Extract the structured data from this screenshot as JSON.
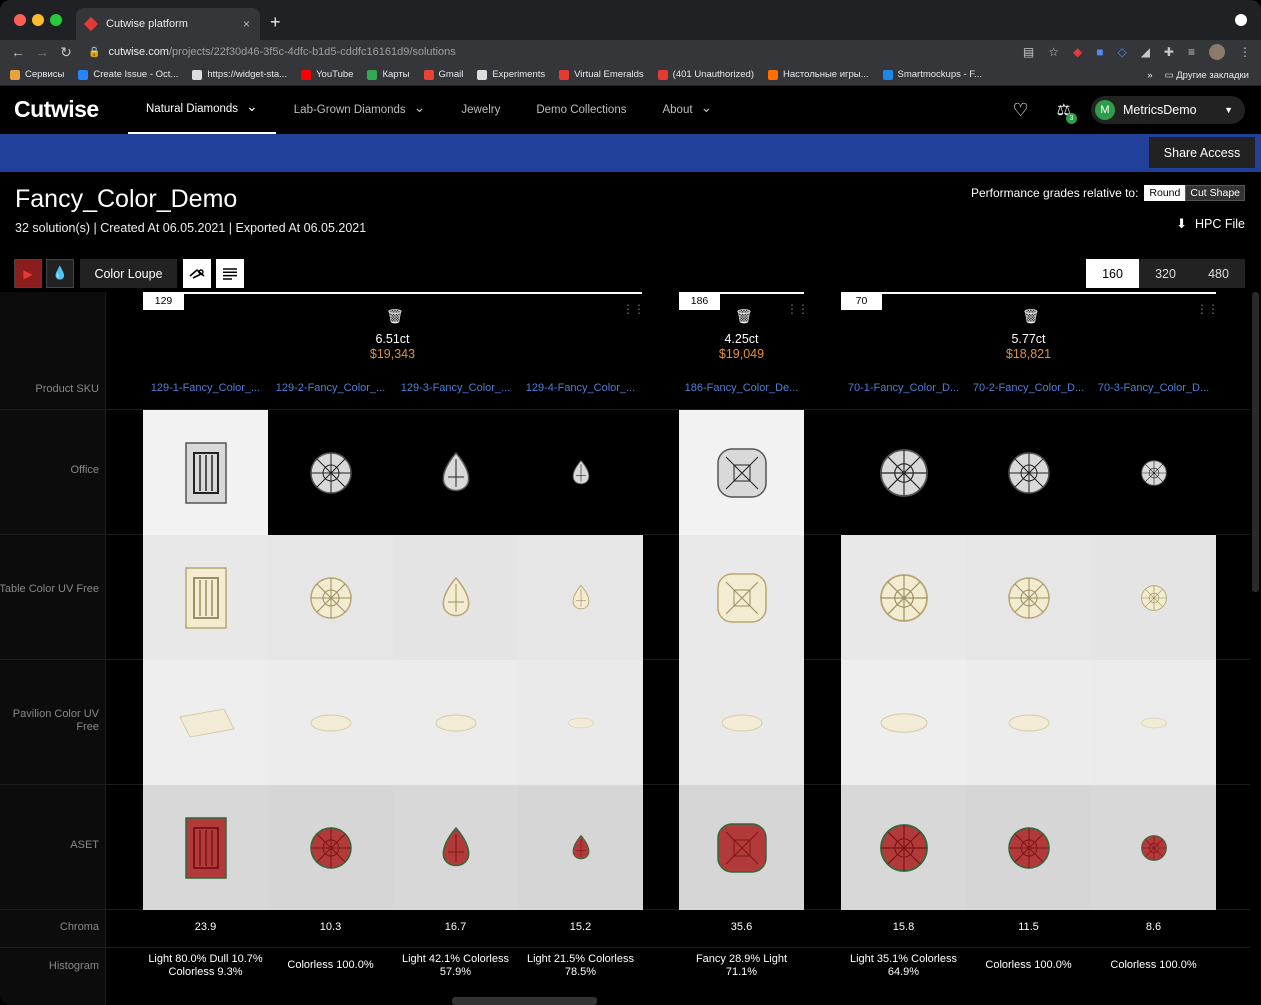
{
  "browser": {
    "tab_title": "Cutwise platform",
    "close": "×",
    "new_tab": "+",
    "url_host": "cutwise.com",
    "url_path": "/projects/22f30d46-3f5c-4dfc-b1d5-cddfc16161d9/solutions",
    "bookmarks": [
      {
        "label": "Сервисы",
        "color": "#e8a33b"
      },
      {
        "label": "Create Issue - Oct...",
        "color": "#2684ff"
      },
      {
        "label": "https://widget-sta...",
        "color": "#dddddd"
      },
      {
        "label": "YouTube",
        "color": "#ff0000"
      },
      {
        "label": "Карты",
        "color": "#34a853"
      },
      {
        "label": "Gmail",
        "color": "#ea4335"
      },
      {
        "label": "Experiments",
        "color": "#dddddd"
      },
      {
        "label": "Virtual Emeralds",
        "color": "#e53935"
      },
      {
        "label": "(401 Unauthorized)",
        "color": "#e53935"
      },
      {
        "label": "Настольные игры...",
        "color": "#ff6f00"
      },
      {
        "label": "Smartmockups - F...",
        "color": "#1e88e5"
      }
    ],
    "bookmarks_more": "»",
    "other_bookmarks": "Другие закладки"
  },
  "header": {
    "logo": "Cutwise",
    "menu": [
      {
        "label": "Natural Diamonds",
        "chevron": true,
        "active": true
      },
      {
        "label": "Lab-Grown Diamonds",
        "chevron": true,
        "active": false
      },
      {
        "label": "Jewelry",
        "chevron": false,
        "active": false
      },
      {
        "label": "Demo Collections",
        "chevron": false,
        "active": false
      },
      {
        "label": "About",
        "chevron": true,
        "active": false
      }
    ],
    "compare_count": "3",
    "user_initial": "M",
    "user_name": "MetricsDemo"
  },
  "share_access": "Share Access",
  "page": {
    "title": "Fancy_Color_Demo",
    "meta": "32 solution(s)  | Created At 06.05.2021  | Exported At 06.05.2021",
    "perf_label": "Performance grades relative to:",
    "perf_options": [
      "Round",
      "Cut Shape"
    ],
    "hpc_file": "HPC File"
  },
  "toolbar": {
    "color_loupe": "Color Loupe",
    "sizes": [
      "160",
      "320",
      "480"
    ],
    "selected_size": "160"
  },
  "row_labels": {
    "sku": "Product SKU",
    "office": "Office",
    "table_uv": "Table Color UV Free",
    "pavilion_uv": "Pavilion Color UV Free",
    "aset": "ASET",
    "chroma": "Chroma",
    "histogram": "Histogram"
  },
  "groups": [
    {
      "id": "129",
      "carat": "6.51ct",
      "price": "$19,343",
      "items": [
        {
          "sku": "129-1-Fancy_Color_...",
          "shape": "emerald",
          "chroma": "23.9",
          "histogram": "Light 80.0% Dull 10.7% Colorless 9.3%",
          "office_bg": "light"
        },
        {
          "sku": "129-2-Fancy_Color_...",
          "shape": "round",
          "chroma": "10.3",
          "histogram": "Colorless 100.0%",
          "office_bg": "dark"
        },
        {
          "sku": "129-3-Fancy_Color_...",
          "shape": "pear",
          "chroma": "16.7",
          "histogram": "Light 42.1% Colorless 57.9%",
          "office_bg": "dark"
        },
        {
          "sku": "129-4-Fancy_Color_...",
          "shape": "pear-small",
          "chroma": "15.2",
          "histogram": "Light 21.5% Colorless 78.5%",
          "office_bg": "dark"
        }
      ]
    },
    {
      "id": "186",
      "carat": "4.25ct",
      "price": "$19,049",
      "items": [
        {
          "sku": "186-Fancy_Color_De...",
          "shape": "cushion",
          "chroma": "35.6",
          "histogram": "Fancy 28.9% Light 71.1%",
          "office_bg": "light"
        }
      ]
    },
    {
      "id": "70",
      "carat": "5.77ct",
      "price": "$18,821",
      "items": [
        {
          "sku": "70-1-Fancy_Color_D...",
          "shape": "round-large",
          "chroma": "15.8",
          "histogram": "Light 35.1% Colorless 64.9%",
          "office_bg": "dark"
        },
        {
          "sku": "70-2-Fancy_Color_D...",
          "shape": "round",
          "chroma": "11.5",
          "histogram": "Colorless 100.0%",
          "office_bg": "dark"
        },
        {
          "sku": "70-3-Fancy_Color_D...",
          "shape": "round-small",
          "chroma": "8.6",
          "histogram": "Colorless 100.0%",
          "office_bg": "dark"
        }
      ]
    }
  ],
  "colors": {
    "brand_blue": "#21409a",
    "price_orange": "#e0913a",
    "link_blue": "#4d7fd6",
    "accent_green": "#2e9d4a"
  }
}
